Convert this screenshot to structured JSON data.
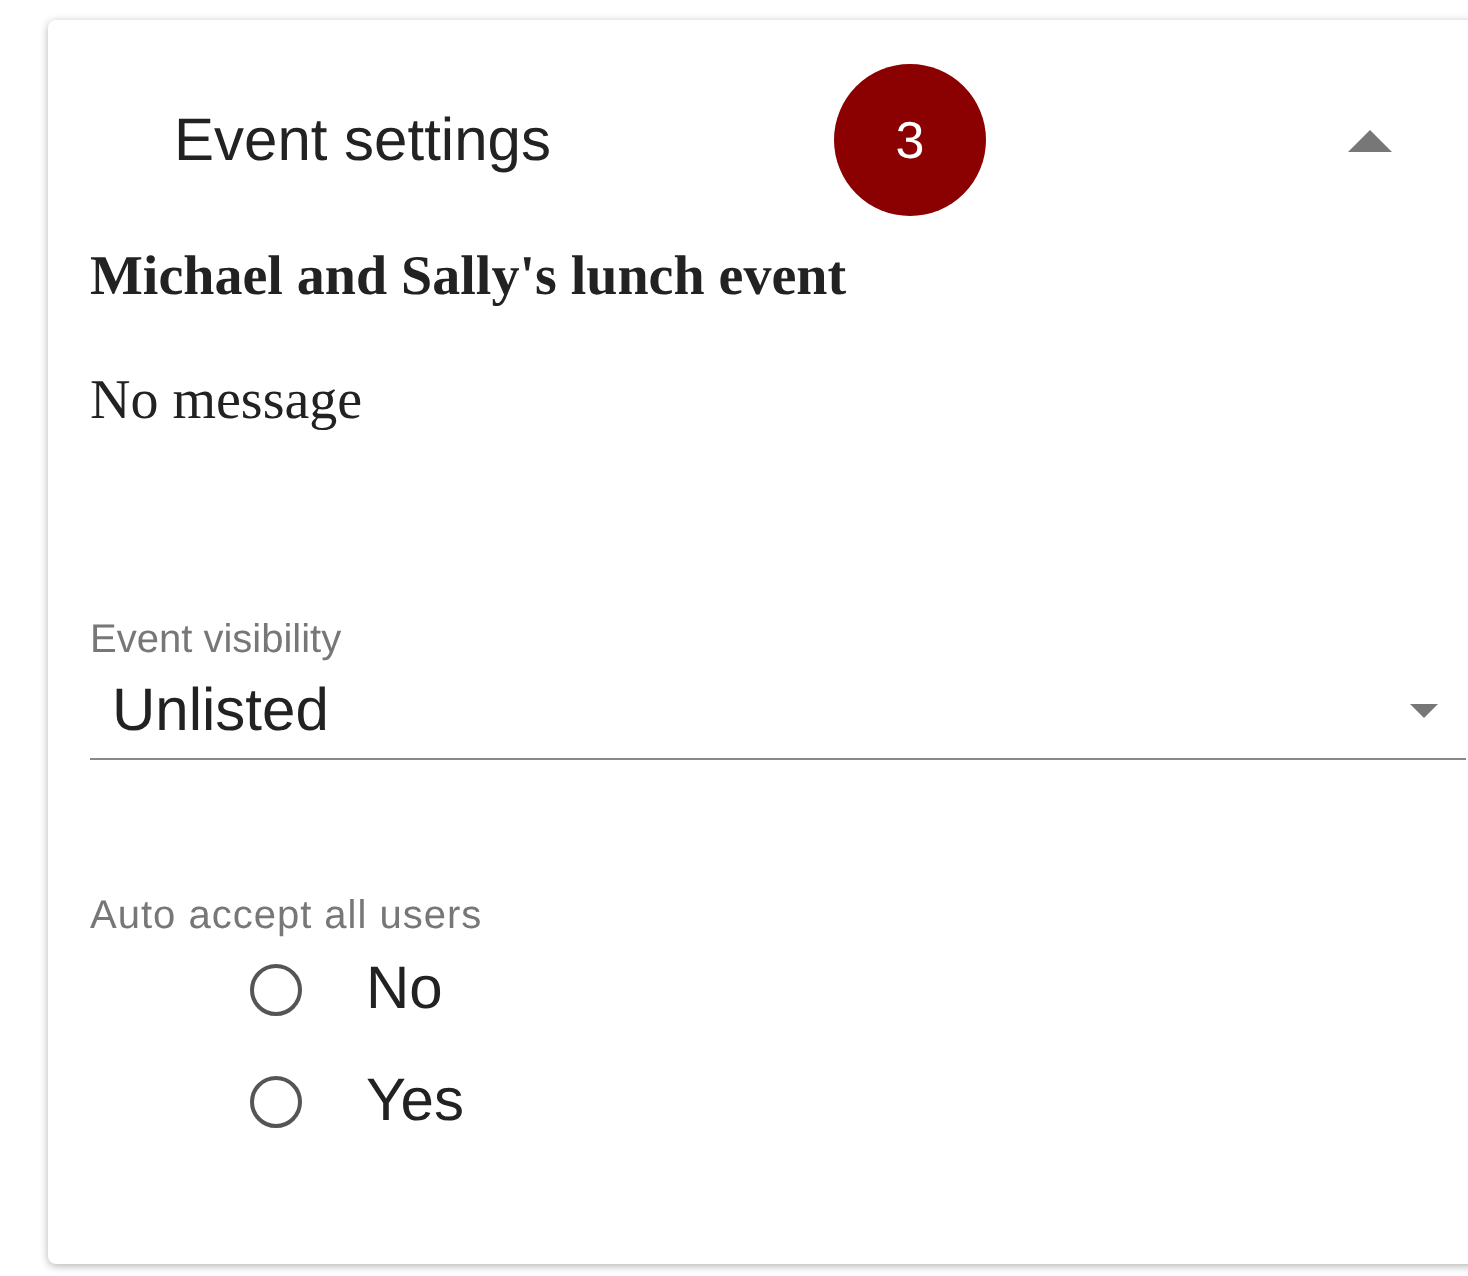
{
  "panel": {
    "title": "Event settings",
    "badge": "3",
    "expanded": true
  },
  "event": {
    "name": "Michael and Sally's lunch event",
    "message": "No message"
  },
  "visibility": {
    "label": "Event visibility",
    "value": "Unlisted"
  },
  "auto_accept": {
    "label": "Auto accept all users",
    "options": [
      {
        "label": "No",
        "selected": false
      },
      {
        "label": "Yes",
        "selected": false
      }
    ]
  }
}
